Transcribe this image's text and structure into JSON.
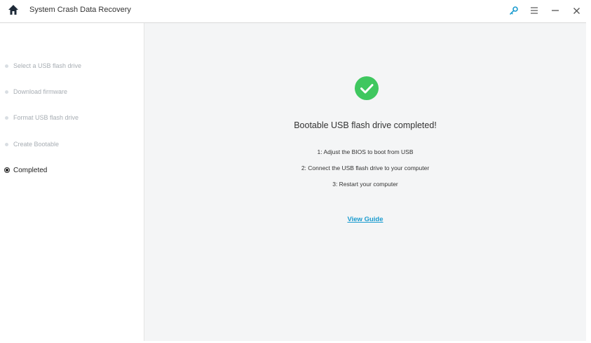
{
  "window": {
    "title": "System Crash Data Recovery",
    "controls": [
      "key-icon",
      "menu-icon",
      "minimize-icon",
      "close-icon"
    ],
    "accent_color": "#1a9bcf"
  },
  "sidebar": {
    "steps": [
      {
        "label": "Select a USB flash drive",
        "state": "done"
      },
      {
        "label": "Download firmware",
        "state": "done"
      },
      {
        "label": "Format USB flash drive",
        "state": "done"
      },
      {
        "label": "Create Bootable",
        "state": "done"
      },
      {
        "label": "Completed",
        "state": "current"
      }
    ]
  },
  "main": {
    "status_icon": "check-circle-icon",
    "status_color": "#3fc75f",
    "headline": "Bootable USB flash drive completed!",
    "instructions": [
      "1: Adjust the BIOS to boot from USB",
      "2: Connect the USB flash drive to your computer",
      "3: Restart your computer"
    ],
    "guide_link": "View Guide"
  }
}
